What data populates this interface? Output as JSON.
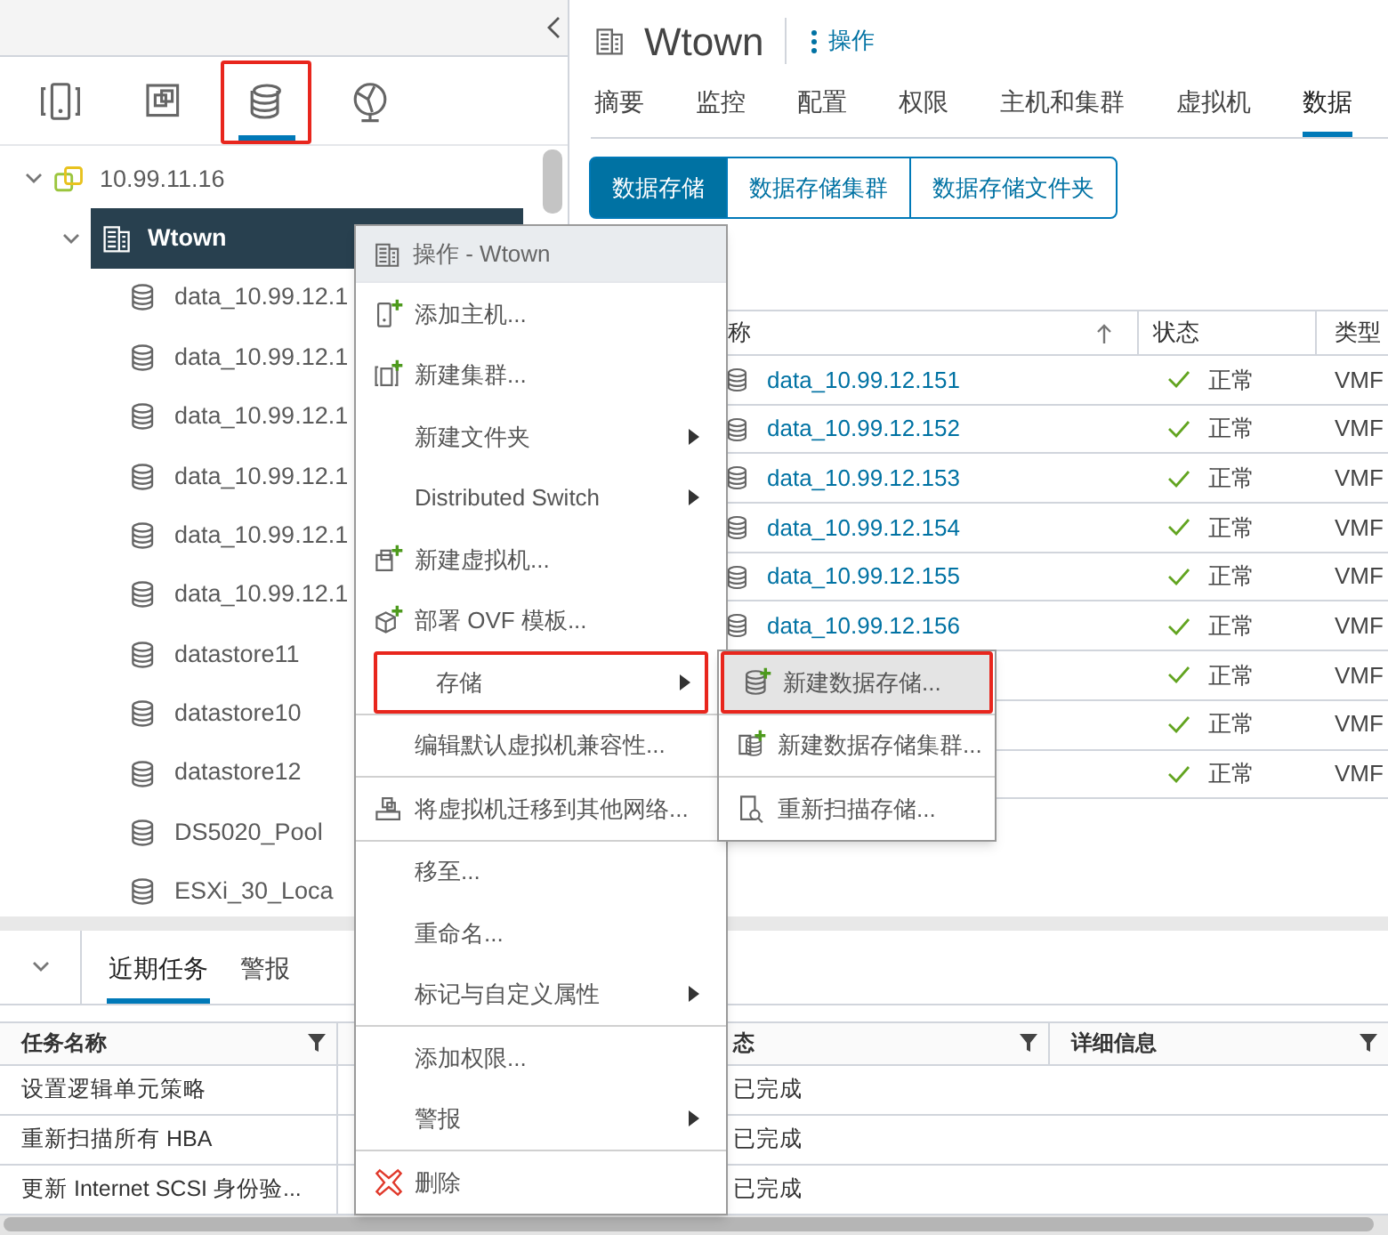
{
  "left_panel": {
    "view_tabs": [
      {
        "selected": false,
        "marked": false
      },
      {
        "selected": false,
        "marked": false
      },
      {
        "selected": true,
        "marked": true
      },
      {
        "selected": false,
        "marked": false
      }
    ],
    "tree": [
      {
        "label": "10.99.11.16",
        "kind": "datacenter",
        "expanded": true,
        "selected": false,
        "children": [
          {
            "label": "Wtown",
            "kind": "building",
            "expanded": true,
            "selected": true,
            "children": [
              {
                "label": "data_10.99.12.1",
                "kind": "datastore",
                "selected": false
              },
              {
                "label": "data_10.99.12.1",
                "kind": "datastore",
                "selected": false
              },
              {
                "label": "data_10.99.12.1",
                "kind": "datastore",
                "selected": false
              },
              {
                "label": "data_10.99.12.1",
                "kind": "datastore",
                "selected": false
              },
              {
                "label": "data_10.99.12.1",
                "kind": "datastore",
                "selected": false
              },
              {
                "label": "data_10.99.12.1",
                "kind": "datastore",
                "selected": false
              },
              {
                "label": "datastore11",
                "kind": "datastore",
                "selected": false
              },
              {
                "label": "datastore10",
                "kind": "datastore",
                "selected": false
              },
              {
                "label": "datastore12",
                "kind": "datastore",
                "selected": false
              },
              {
                "label": "DS5020_Pool",
                "kind": "datastore",
                "selected": false
              },
              {
                "label": "ESXi_30_Loca",
                "kind": "datastore",
                "selected": false
              }
            ]
          }
        ]
      }
    ]
  },
  "header": {
    "title": "Wtown",
    "actions": "操作"
  },
  "tabs": [
    {
      "label": "摘要",
      "selected": false
    },
    {
      "label": "监控",
      "selected": false
    },
    {
      "label": "配置",
      "selected": false
    },
    {
      "label": "权限",
      "selected": false
    },
    {
      "label": "主机和集群",
      "selected": false
    },
    {
      "label": "虚拟机",
      "selected": false
    },
    {
      "label": "数据",
      "selected": true
    }
  ],
  "sub_tabs": [
    {
      "label": "数据存储",
      "selected": true
    },
    {
      "label": "数据存储集群",
      "selected": false
    },
    {
      "label": "数据存储文件夹",
      "selected": false
    }
  ],
  "datastore_table": {
    "columns": [
      "称",
      "状态",
      "类型"
    ],
    "rows": [
      {
        "name": "data_10.99.12.151",
        "status": "正常",
        "type": "VMF"
      },
      {
        "name": "data_10.99.12.152",
        "status": "正常",
        "type": "VMF"
      },
      {
        "name": "data_10.99.12.153",
        "status": "正常",
        "type": "VMF"
      },
      {
        "name": "data_10.99.12.154",
        "status": "正常",
        "type": "VMF"
      },
      {
        "name": "data_10.99.12.155",
        "status": "正常",
        "type": "VMF"
      },
      {
        "name": "data_10.99.12.156",
        "status": "正常",
        "type": "VMF"
      },
      {
        "status": "正常",
        "type": "VMF"
      },
      {
        "status": "正常",
        "type": "VMF"
      },
      {
        "status": "正常",
        "type": "VMF"
      }
    ]
  },
  "bottom_panel": {
    "tabs": [
      {
        "label": "近期任务",
        "selected": true
      },
      {
        "label": "警报",
        "selected": false
      }
    ],
    "columns": [
      "任务名称",
      "态",
      "详细信息"
    ],
    "rows": [
      {
        "task": "设置逻辑单元策略",
        "status": "已完成"
      },
      {
        "task": "重新扫描所有 HBA",
        "status": "已完成"
      },
      {
        "task": "更新 Internet SCSI 身份验...",
        "status": "已完成"
      }
    ]
  },
  "context_menu": {
    "title": "操作 - Wtown",
    "items": [
      {
        "kind": "item",
        "label": "添加主机...",
        "submenu": false,
        "marked": false
      },
      {
        "kind": "item",
        "label": "新建集群...",
        "submenu": false,
        "marked": false
      },
      {
        "kind": "item",
        "label": "新建文件夹",
        "submenu": true,
        "marked": false
      },
      {
        "kind": "item",
        "label": "Distributed Switch",
        "submenu": true,
        "marked": false
      },
      {
        "kind": "item",
        "label": "新建虚拟机...",
        "submenu": false,
        "marked": false
      },
      {
        "kind": "item",
        "label": "部署 OVF 模板...",
        "submenu": false,
        "marked": false
      },
      {
        "kind": "item",
        "label": "存储",
        "submenu": true,
        "marked": true
      },
      {
        "kind": "separator"
      },
      {
        "kind": "item",
        "label": "编辑默认虚拟机兼容性...",
        "submenu": false,
        "marked": false
      },
      {
        "kind": "separator"
      },
      {
        "kind": "item",
        "label": "将虚拟机迁移到其他网络...",
        "submenu": false,
        "marked": false
      },
      {
        "kind": "separator"
      },
      {
        "kind": "item",
        "label": "移至...",
        "submenu": false,
        "marked": false
      },
      {
        "kind": "item",
        "label": "重命名...",
        "submenu": false,
        "marked": false
      },
      {
        "kind": "item",
        "label": "标记与自定义属性",
        "submenu": true,
        "marked": false
      },
      {
        "kind": "separator"
      },
      {
        "kind": "item",
        "label": "添加权限...",
        "submenu": false,
        "marked": false
      },
      {
        "kind": "item",
        "label": "警报",
        "submenu": true,
        "marked": false
      },
      {
        "kind": "separator"
      },
      {
        "kind": "item",
        "label": "删除",
        "submenu": false,
        "marked": false
      }
    ]
  },
  "submenu": {
    "items": [
      {
        "kind": "item",
        "label": "新建数据存储...",
        "selected": true,
        "marked": true
      },
      {
        "kind": "separator"
      },
      {
        "kind": "item",
        "label": "新建数据存储集群...",
        "selected": false,
        "marked": false
      },
      {
        "kind": "separator"
      },
      {
        "kind": "item",
        "label": "重新扫描存储...",
        "selected": false,
        "marked": false
      }
    ]
  }
}
